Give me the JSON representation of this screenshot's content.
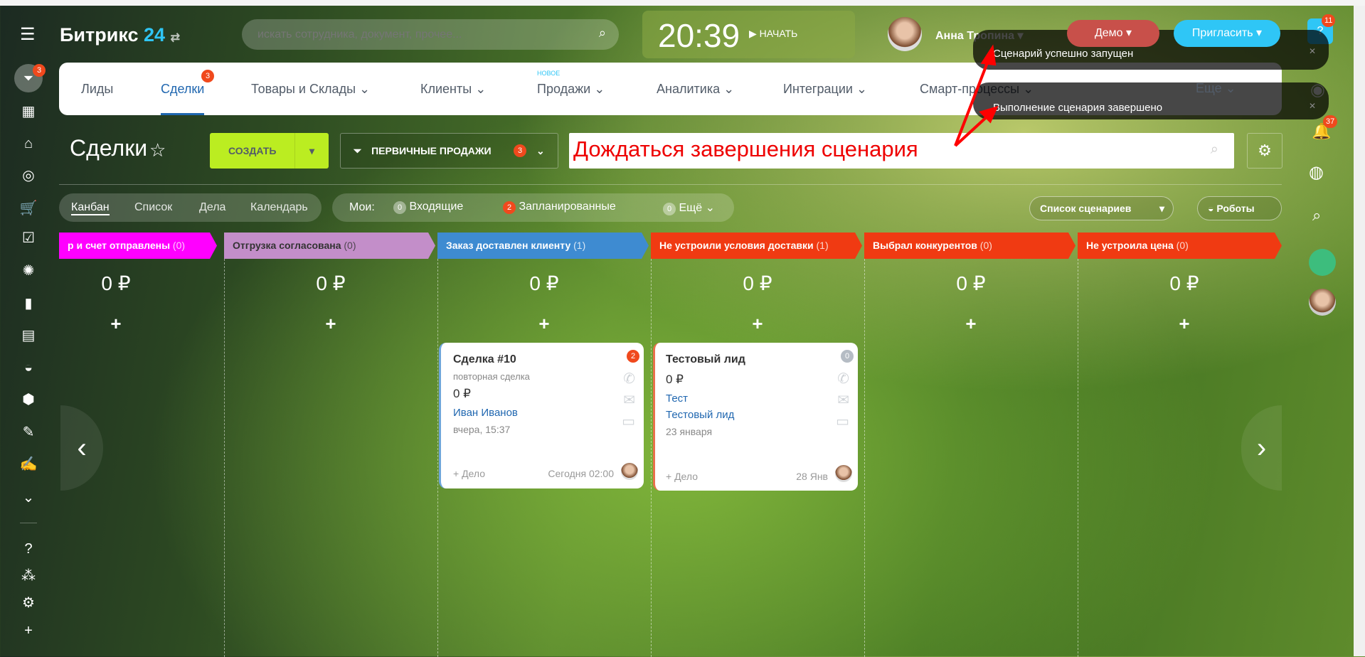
{
  "header": {
    "logo": "Битрикс",
    "logo_num": "24",
    "search_placeholder": "искать сотрудника, документ, прочее...",
    "time": "20:39",
    "start_label": "НАЧАТЬ",
    "user_name": "Анна Тропина",
    "demo_label": "Демо",
    "invite_label": "Пригласить"
  },
  "sidebar": {
    "deals_badge": "3"
  },
  "rightbar": {
    "help_badge": "11",
    "notif_badge": "37"
  },
  "nav": {
    "items": [
      {
        "label": "Лиды"
      },
      {
        "label": "Сделки",
        "badge": "3"
      },
      {
        "label": "Товары и Склады"
      },
      {
        "label": "Клиенты"
      },
      {
        "label": "Продажи",
        "tag": "НОВОЕ"
      },
      {
        "label": "Аналитика"
      },
      {
        "label": "Интеграции"
      },
      {
        "label": "Смарт-процессы"
      },
      {
        "label": "Еще"
      }
    ]
  },
  "toolbar": {
    "title": "Сделки",
    "create_label": "СОЗДАТЬ",
    "category_label": "ПЕРВИЧНЫЕ ПРОДАЖИ",
    "category_badge": "3"
  },
  "annotation": "Дождаться завершения сценария",
  "views": {
    "items": [
      "Канбан",
      "Список",
      "Дела",
      "Календарь"
    ],
    "my_label": "Мои:",
    "counters": [
      {
        "count": "0",
        "label": "Входящие"
      },
      {
        "count": "2",
        "label": "Запланированные"
      },
      {
        "count": "0",
        "label": "Ещё"
      }
    ]
  },
  "actions": {
    "scenarios_label": "Список сценариев",
    "robots_label": "Роботы"
  },
  "stages": [
    {
      "name": "р и счет отправлены",
      "count": "(0)",
      "sum": "0 ₽",
      "color": "#ff00ff"
    },
    {
      "name": "Отгрузка согласована",
      "count": "(0)",
      "sum": "0 ₽",
      "color": "#c38ec9"
    },
    {
      "name": "Заказ доставлен клиенту",
      "count": "(1)",
      "sum": "0 ₽",
      "color": "#3e8bd1"
    },
    {
      "name": "Не устроили условия доставки",
      "count": "(1)",
      "sum": "0 ₽",
      "color": "#f03a12"
    },
    {
      "name": "Выбрал конкурентов",
      "count": "(0)",
      "sum": "0 ₽",
      "color": "#f03a12"
    },
    {
      "name": "Не устроила цена",
      "count": "(0)",
      "sum": "0 ₽",
      "color": "#f03a12"
    }
  ],
  "cards": [
    {
      "title": "Сделка #10",
      "subtitle": "повторная сделка",
      "sum": "0 ₽",
      "contact": "Иван Иванов",
      "date": "вчера, 15:37",
      "badge": "2",
      "add_label": "+ Дело",
      "deadline": "Сегодня 02:00"
    },
    {
      "title": "Тестовый лид",
      "sum": "0 ₽",
      "contact": "Тест",
      "company": "Тестовый лид",
      "date": "23 января",
      "badge": "0",
      "add_label": "+ Дело",
      "deadline": "28 Янв"
    }
  ],
  "notifications": [
    "Сценарий успешно запущен",
    "Выполнение сценария завершено"
  ]
}
